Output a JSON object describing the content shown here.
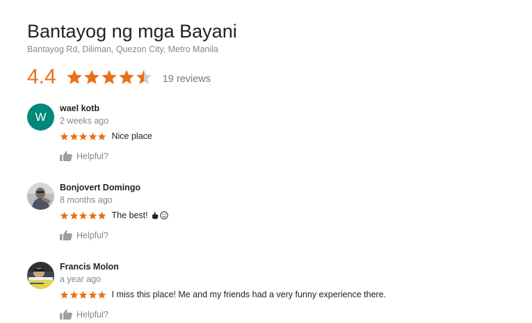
{
  "place": {
    "title": "Bantayog ng mga Bayani",
    "address": "Bantayog Rd, Diliman, Quezon City, Metro Manila"
  },
  "summary": {
    "rating": "4.4",
    "rating_value": 4.4,
    "reviews_count": "19 reviews"
  },
  "colors": {
    "star": "#e7711b",
    "star_empty": "#cfcfcf",
    "avatar_teal": "#00897b",
    "muted_text": "#878787"
  },
  "icons": {
    "star": "star-icon",
    "thumb": "thumbs-up-icon"
  },
  "reviews": [
    {
      "avatar_letter": "W",
      "name": "wael kotb",
      "time": "2 weeks ago",
      "stars": 5,
      "text": "Nice place",
      "helpful": "Helpful?"
    },
    {
      "avatar_letter": "",
      "name": "Bonjovert Domingo",
      "time": "8 months ago",
      "stars": 5,
      "text": "The best!",
      "emoji": [
        "pointing-hand-emoji",
        "smiling-face-emoji"
      ],
      "helpful": "Helpful?"
    },
    {
      "avatar_letter": "",
      "name": "Francis Molon",
      "time": "a year ago",
      "stars": 5,
      "text": "I miss this place! Me and my friends had a very funny experience there.",
      "helpful": "Helpful?"
    }
  ]
}
